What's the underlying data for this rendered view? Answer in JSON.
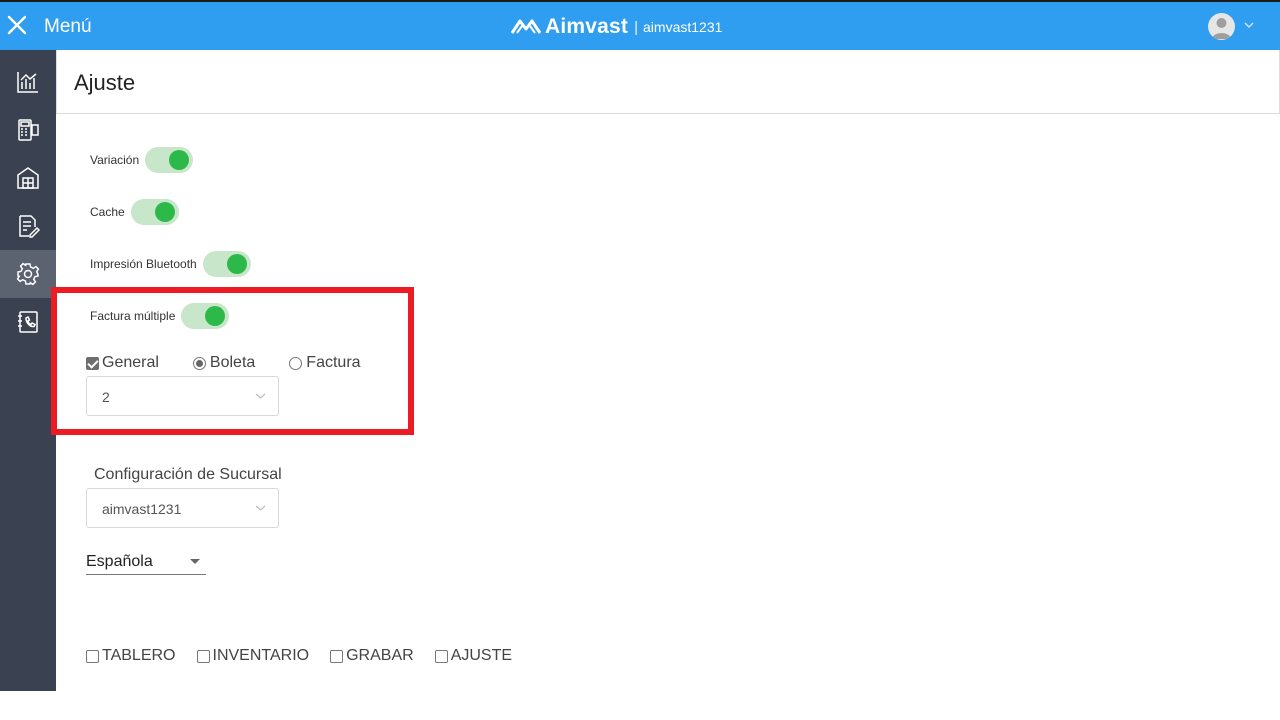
{
  "header": {
    "menu_label": "Menú",
    "brand_name": "Aimvast",
    "separator": "|",
    "username": "aimvast1231"
  },
  "colors": {
    "header_bg": "#2f9df0",
    "sidebar_bg": "#3a4150",
    "sidebar_active_bg": "#5b6270",
    "toggle_on_track": "#c8e6c9",
    "toggle_on_knob": "#2db84a",
    "highlight_border": "#ed1c24"
  },
  "sidebar": {
    "items": [
      {
        "icon": "dashboard-chart-icon",
        "active": false
      },
      {
        "icon": "pos-register-icon",
        "active": false
      },
      {
        "icon": "warehouse-icon",
        "active": false
      },
      {
        "icon": "report-edit-icon",
        "active": false
      },
      {
        "icon": "gear-icon",
        "active": true
      },
      {
        "icon": "contacts-phone-icon",
        "active": false
      }
    ]
  },
  "page": {
    "title": "Ajuste"
  },
  "toggles": [
    {
      "label": "Variación",
      "on": true
    },
    {
      "label": "Cache",
      "on": true
    },
    {
      "label": "Impresión Bluetooth",
      "on": true
    },
    {
      "label": "Factura múltiple",
      "on": true
    }
  ],
  "invoice_options": {
    "general": {
      "label": "General",
      "checked": true
    },
    "boleta": {
      "label": "Boleta",
      "checked": true
    },
    "factura": {
      "label": "Factura",
      "checked": false
    },
    "count_value": "2"
  },
  "branch": {
    "label": "Configuración de Sucursal",
    "value": "aimvast1231"
  },
  "language": {
    "value": "Española"
  },
  "permissions": [
    {
      "label": "TABLERO",
      "checked": false
    },
    {
      "label": "INVENTARIO",
      "checked": false
    },
    {
      "label": "GRABAR",
      "checked": false
    },
    {
      "label": "AJUSTE",
      "checked": false
    }
  ]
}
